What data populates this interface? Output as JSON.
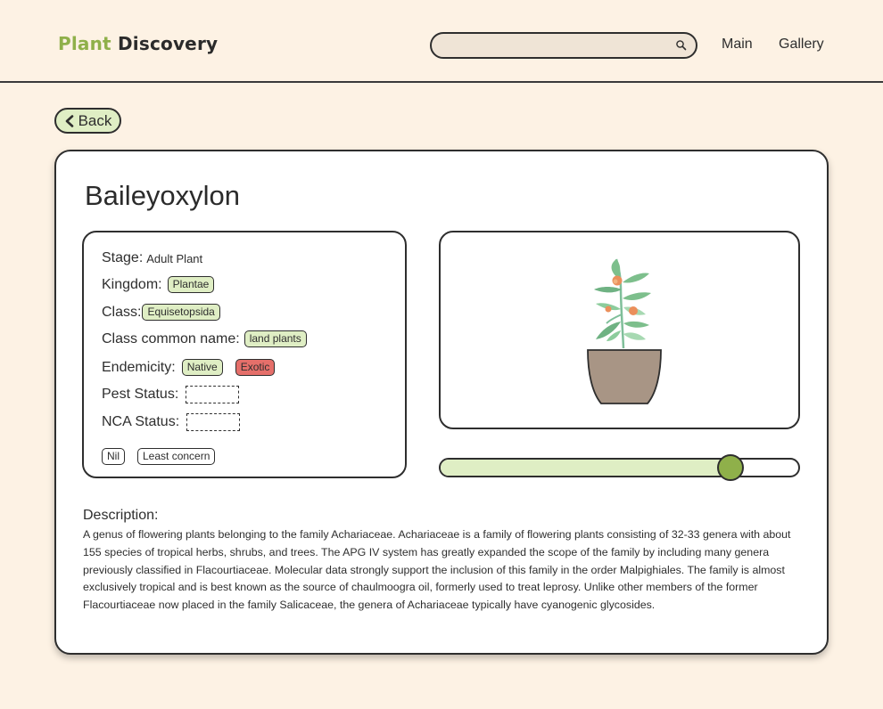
{
  "header": {
    "logo_part1": "Plant",
    "logo_part2": "Discovery",
    "search_placeholder": "",
    "nav": [
      "Main",
      "Gallery"
    ]
  },
  "back_label": "Back",
  "plant": {
    "name": "Baileyoxylon",
    "stage_label": "Stage:",
    "stage_value": "Adult Plant",
    "kingdom_label": "Kingdom:",
    "kingdom_value": "Plantae",
    "class_label": "Class:",
    "class_value": "Equisetopsida",
    "class_common_label": "Class common name:",
    "class_common_value": "land plants",
    "endemicity_label": "Endemicity:",
    "endemicity_values": [
      "Native",
      "Exotic"
    ],
    "pest_label": "Pest Status:",
    "nca_label": "NCA Status:",
    "legend": [
      "Nil",
      "Least concern"
    ]
  },
  "slider": {
    "value": 0.81
  },
  "description": {
    "label": "Description:",
    "text": "A genus of flowering plants belonging to the family Achariaceae. Achariaceae is a family of flowering plants consisting of 32-33 genera with about 155 species of tropical herbs, shrubs, and trees. The APG IV system has greatly expanded the scope of the family by including many genera previously classified in Flacourtiaceae. Molecular data strongly support the inclusion of this family in the order Malpighiales. The family is almost exclusively tropical and is best known as the source of chaulmoogra oil, formerly used to treat leprosy. Unlike other members of the former Flacourtiaceae now placed in the family Salicaceae, the genera of Achariaceae typically have cyanogenic glycosides."
  },
  "colors": {
    "background": "#fdf2e4",
    "accent_green": "#8fb04a",
    "tag_green": "#dfeec4",
    "tag_red": "#e56f6a",
    "pot": "#a89585"
  }
}
